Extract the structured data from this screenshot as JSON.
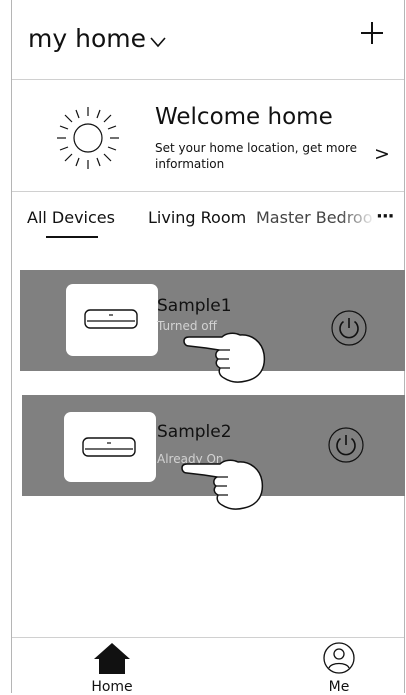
{
  "header": {
    "title": "my home"
  },
  "welcome": {
    "title": "Welcome home",
    "subtitle": "Set your home location, get more information",
    "arrow": ">"
  },
  "tabs": {
    "items": [
      {
        "label": "All Devices",
        "selected": true
      },
      {
        "label": "Living Room",
        "selected": false
      },
      {
        "label": "Master Bedroom",
        "selected": false
      }
    ],
    "more": "···"
  },
  "devices": [
    {
      "name": "Sample1",
      "status": "Turned off"
    },
    {
      "name": "Sample2",
      "status": "Already On"
    }
  ],
  "nav": {
    "home_label": "Home",
    "me_label": "Me"
  },
  "colors": {
    "card_bg": "#808080",
    "status_text": "#d2d2d2",
    "background": "#ffffff"
  },
  "icons": [
    "chevron-down-icon",
    "plus-icon",
    "sun-icon",
    "air-conditioner-icon",
    "power-icon",
    "pointing-hand-icon",
    "home-icon",
    "user-icon"
  ]
}
